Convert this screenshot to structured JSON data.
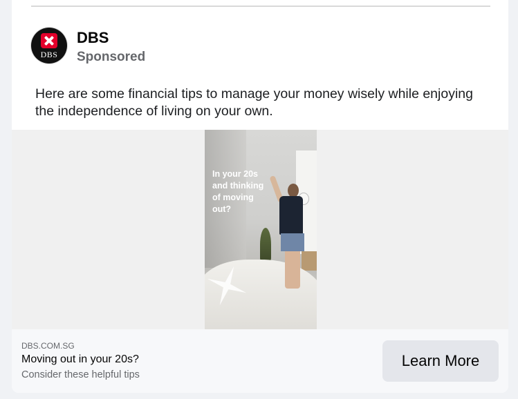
{
  "post": {
    "page_name": "DBS",
    "sponsored_label": "Sponsored",
    "avatar_text": "DBS",
    "body_text": "Here are some financial tips to manage your money wisely while enjoying the independence of living on your own."
  },
  "media": {
    "overlay_text": "In your 20s\nand thinking\nof moving\nout?"
  },
  "link_footer": {
    "domain": "DBS.COM.SG",
    "headline": "Moving out in your 20s?",
    "description": "Consider these helpful tips",
    "cta_label": "Learn More"
  },
  "colors": {
    "brand_red": "#e3002b",
    "cta_background": "#e4e6eb",
    "secondary_text": "#65676b"
  }
}
